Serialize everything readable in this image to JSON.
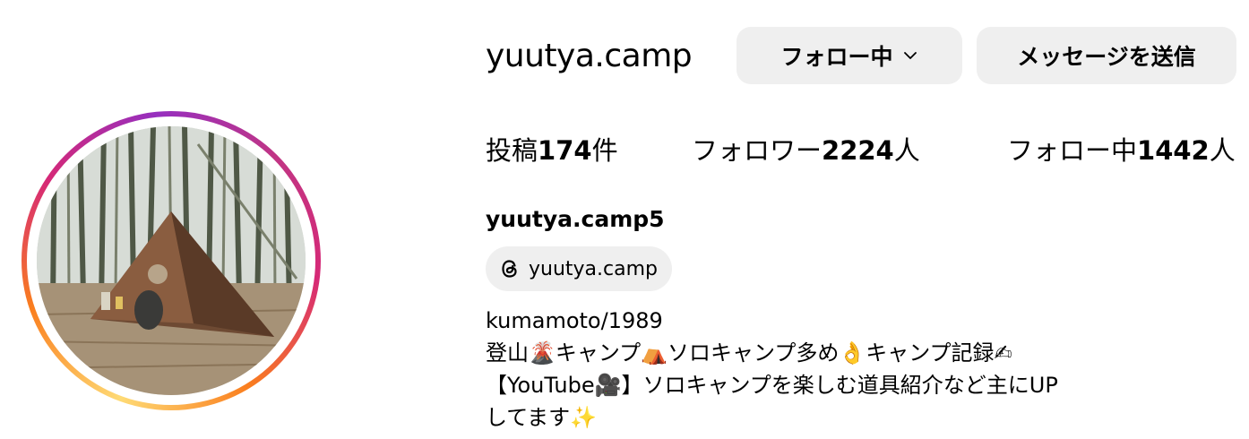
{
  "profile": {
    "username": "yuutya.camp",
    "full_name": "yuutya.camp5",
    "avatar": "avatar-tent-in-bamboo-forest"
  },
  "actions": {
    "following_label": "フォロー中",
    "message_label": "メッセージを送信"
  },
  "stats": {
    "posts_prefix": "投稿",
    "posts_count": "174",
    "posts_suffix": "件",
    "followers_prefix": "フォロワー",
    "followers_count": "2224",
    "followers_suffix": "人",
    "following_prefix": "フォロー中",
    "following_count": "1442",
    "following_suffix": "人"
  },
  "threads": {
    "icon": "threads-icon",
    "handle": "yuutya.camp"
  },
  "bio": {
    "lines": [
      "kumamoto/1989",
      "登山🌋キャンプ⛺ソロキャンプ多め👌キャンプ記録✍",
      "【YouTube🎥】ソロキャンプを楽しむ道具紹介など主にUP",
      "してます✨"
    ]
  },
  "colors": {
    "button_bg": "#efefef",
    "text": "#000000",
    "ring_gradient": [
      "#feda75",
      "#fa7e1e",
      "#d62976",
      "#962fbf"
    ]
  }
}
